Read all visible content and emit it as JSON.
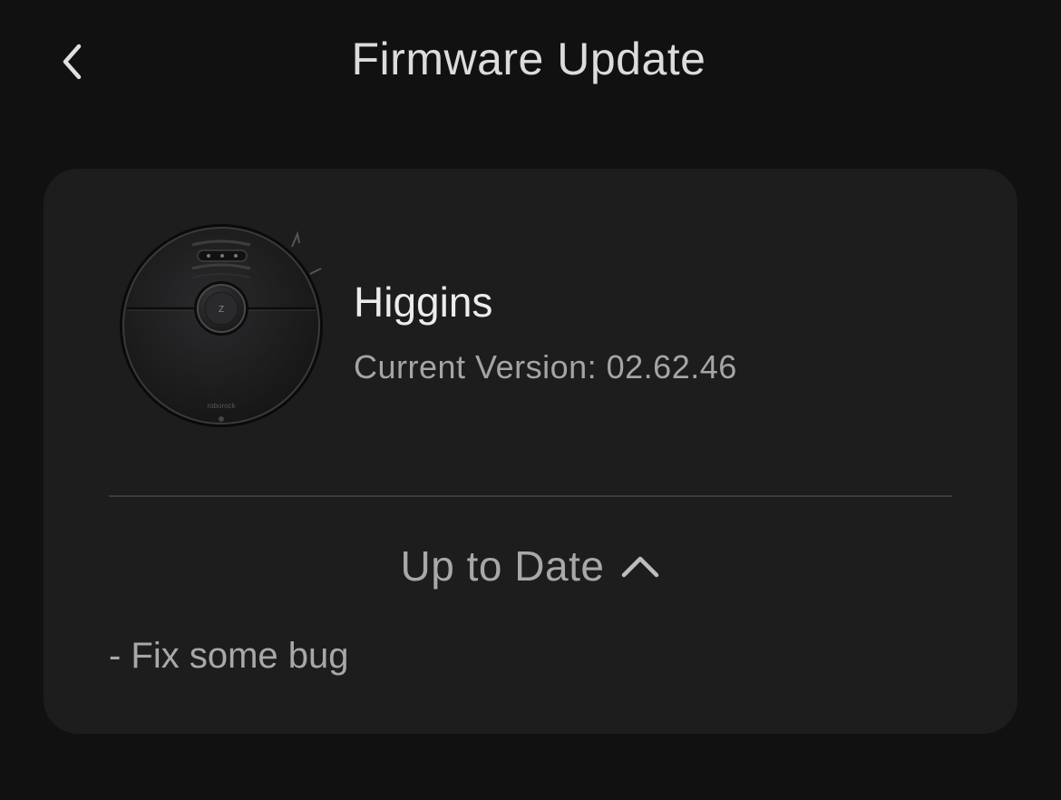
{
  "header": {
    "title": "Firmware Update",
    "back_icon": "chevron-left-icon"
  },
  "device": {
    "name": "Higgins",
    "version_label": "Current Version: 02.62.46",
    "image": "robot-vacuum-image",
    "brand_mark": "roborock"
  },
  "update": {
    "status": "Up to Date",
    "toggle_icon": "chevron-up-icon",
    "notes": "- Fix some bug"
  },
  "colors": {
    "background": "#111111",
    "card": "#1d1d1d",
    "divider": "#3b3b3b",
    "primary_text": "#ececec",
    "secondary_text": "#a8a8a8"
  }
}
